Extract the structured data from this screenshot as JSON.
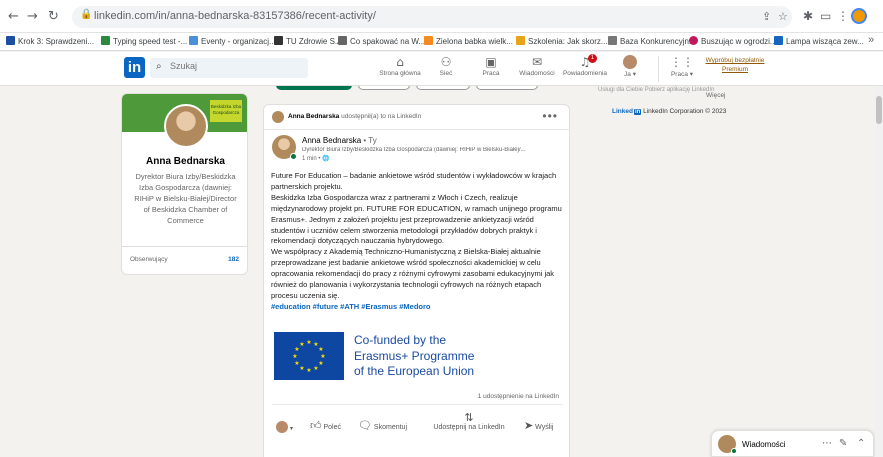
{
  "browser": {
    "url": "linkedin.com/in/anna-bednarska-83157386/recent-activity/",
    "toolbar_icons": [
      "share-icon",
      "star-icon",
      "extensions-icon",
      "sidepanel-icon",
      "profile-icon",
      "menu-icon"
    ]
  },
  "bookmarks": [
    {
      "label": "Krok 3: Sprawdzeni...",
      "color": "#1a4fa3"
    },
    {
      "label": "Typing speed test -...",
      "color": "#2b8a3e"
    },
    {
      "label": "Eventy - organizacj...",
      "color": "#4a90d9"
    },
    {
      "label": "TU Zdrowie S.A.",
      "color": "#333333"
    },
    {
      "label": "Co spakować na W...",
      "color": "#666666"
    },
    {
      "label": "Zielona babka wielk...",
      "color": "#f28b22"
    },
    {
      "label": "Szkolenia: Jak skorz...",
      "color": "#e8a317"
    },
    {
      "label": "Baza Konkurencyjn...",
      "color": "#777777"
    },
    {
      "label": "Buszując w ogrodzi...",
      "color": "#c2185b"
    },
    {
      "label": "Lampa wisząca zew...",
      "color": "#1565c0"
    }
  ],
  "linkedin": {
    "logo": "in",
    "search_placeholder": "Szukaj",
    "nav": [
      {
        "label": "Strona główna",
        "icon": "home-icon"
      },
      {
        "label": "Sieć",
        "icon": "network-icon"
      },
      {
        "label": "Praca",
        "icon": "briefcase-icon"
      },
      {
        "label": "Wiadomości",
        "icon": "messaging-icon"
      },
      {
        "label": "Powiadomienia",
        "icon": "bell-icon",
        "badge": "1"
      },
      {
        "label": "Ja ▾",
        "icon": "avatar"
      },
      {
        "label": "Praca ▾",
        "icon": "grid-icon"
      }
    ],
    "premium_line1": "Wypróbuj bezpłatnie",
    "premium_line2": "Premium"
  },
  "profile": {
    "name": "Anna Bednarska",
    "headline": "Dyrektor Biura Izby/Beskidzka Izba Gospodarcza (dawniej: RIHiP w Bielsku-Białej/Director of Beskidzka Chamber of Commerce",
    "followers_label": "Obserwujący",
    "followers_count": "182",
    "banner_badge": "Beskidzka Izba Gospodarcza"
  },
  "post": {
    "reshare_name": "Anna Bednarska",
    "reshare_suffix": " udostępnił(a) to na LinkedIn",
    "author_name": "Anna Bednarska",
    "author_degree": " • Ty",
    "author_title": "Dyrektor Biura Izby/Beskidzka Izba Gospodarcza (dawniej: RIHiP w Bielsku-Białej/...",
    "time": "1 min • 🌐",
    "paragraphs": [
      "Future For Education – badanie ankietowe wśród studentów i wykładowców w krajach partnerskich projektu.",
      "Beskidzka Izba Gospodarcza wraz z partnerami z Włoch i Czech, realizuje międzynarodowy projekt pn. FUTURE FOR EDUCATION, w ramach unijnego programu Erasmus+. Jednym z założeń projektu jest przeprowadzenie ankietyzacji wśród studentów i uczniów celem stworzenia metodologii przykładów dobrych praktyk i rekomendacji dotyczących nauczania hybrydowego.",
      "We współpracy z Akademią Techniczno-Humanistyczną z Bielska-Białej aktualnie przeprowadzane jest badanie ankietowe wśród społeczności akademickiej w celu opracowania rekomendacji do pracy z różnymi cyfrowymi zasobami edukacyjnymi jak również do planowania i wykorzystania technologii cyfrowych na różnych etapach procesu uczenia się."
    ],
    "hashtags": "#education #future #ATH #Erasmus #Medoro",
    "eu_line1": "Co-funded by the",
    "eu_line2": "Erasmus+ Programme",
    "eu_line3": "of the European Union",
    "share_count": "1 udostępnienie na LinkedIn",
    "actions": {
      "like": "Poleć",
      "comment": "Skomentuj",
      "repost": "Udostępnij na LinkedIn",
      "send": "Wyślij"
    }
  },
  "right": {
    "ghost_text": "Usługi dla Ciebie   Pobierz aplikację LinkedIn",
    "more": "Więcej",
    "footer_brand": "Linked",
    "footer_logo": "in",
    "footer_text": " LinkedIn Corporation © 2023"
  },
  "messaging": {
    "label": "Wiadomości"
  },
  "colors": {
    "linkedin_blue": "#0a66c2",
    "premium_gold": "#915907",
    "background": "#f4f2ee",
    "eu_blue": "#0e47a1",
    "eu_text": "#1b4ba0"
  }
}
